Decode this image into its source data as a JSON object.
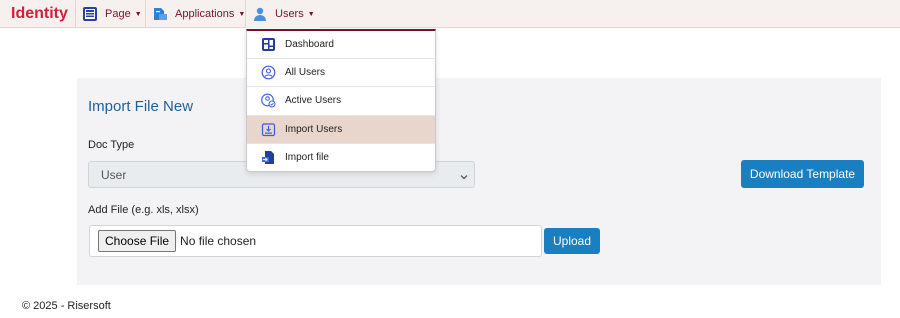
{
  "navbar": {
    "brand": "Identity",
    "items": [
      {
        "label": "Page",
        "icon": "page-grid-icon"
      },
      {
        "label": "Applications",
        "icon": "applications-icon"
      },
      {
        "label": "Users",
        "icon": "user-icon"
      }
    ]
  },
  "dropdown": {
    "items": [
      {
        "label": "Dashboard",
        "icon": "dashboard-icon"
      },
      {
        "label": "All Users",
        "icon": "all-users-icon"
      },
      {
        "label": "Active Users",
        "icon": "active-users-icon"
      },
      {
        "label": "Import Users",
        "icon": "import-users-icon",
        "active": true
      },
      {
        "label": "Import file",
        "icon": "import-file-icon"
      }
    ]
  },
  "form": {
    "title": "Import File New",
    "doc_type_label": "Doc Type",
    "doc_type_value": "User",
    "add_file_label": "Add File (e.g. xls, xlsx)",
    "choose_file_label": "Choose File",
    "no_file_text": "No file chosen",
    "upload_label": "Upload",
    "download_label": "Download Template"
  },
  "footer": {
    "text": "© 2025 - Risersoft"
  },
  "colors": {
    "brand": "#d21f3c",
    "nav_text": "#7a1030",
    "primary_button": "#1a7fc1",
    "title": "#1f5f9a",
    "active_menu_bg": "#e8d5cb"
  }
}
